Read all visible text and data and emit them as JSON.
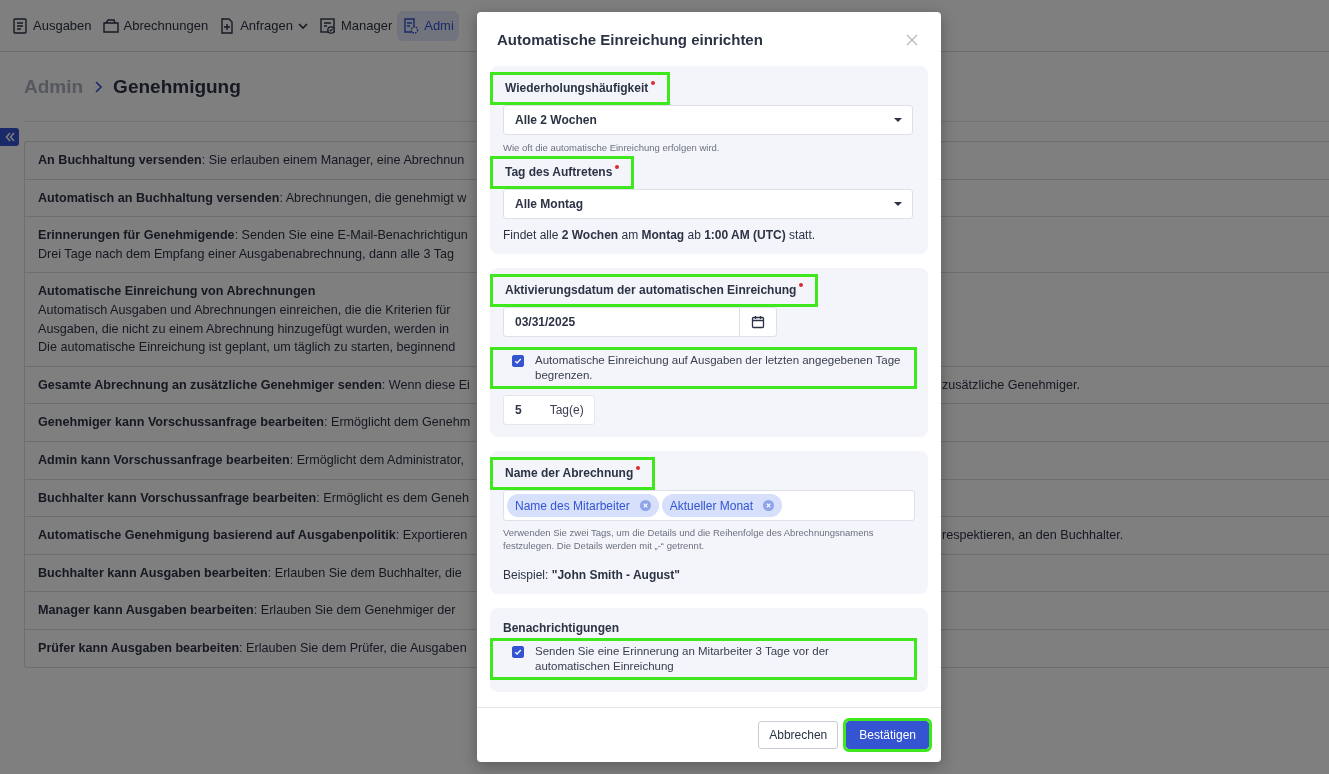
{
  "nav": {
    "items": [
      {
        "label": "Ausgaben",
        "selected": false,
        "dropdown": false
      },
      {
        "label": "Abrechnungen",
        "selected": false,
        "dropdown": false
      },
      {
        "label": "Anfragen",
        "selected": false,
        "dropdown": true
      },
      {
        "label": "Manager",
        "selected": false,
        "dropdown": false
      },
      {
        "label": "Admi",
        "selected": true,
        "dropdown": false
      }
    ]
  },
  "breadcrumb": {
    "parent": "Admin",
    "current": "Genehmigung"
  },
  "settings": {
    "rows": [
      {
        "lines": [
          "**An Buchhaltung versenden**: Sie erlauben einem Manager, eine Abrechnun"
        ]
      },
      {
        "lines": [
          "**Automatisch an Buchhaltung versenden**: Abrechnungen, die genehmigt w"
        ]
      },
      {
        "lines": [
          "**Erinnerungen für Genehmigende**: Senden Sie eine E-Mail-Benachrichtigun",
          "Drei Tage nach dem Empfang einer Ausgabenabrechnung, dann alle 3 Tag"
        ]
      },
      {
        "lines": [
          "**Automatische Einreichung von Abrechnungen**",
          "Automatisch Ausgaben und Abrechnungen einreichen, die die Kriterien für",
          "Ausgaben, die nicht zu einem Abrechnung hinzugefügt wurden, werden in",
          "Die automatische Einreichung ist geplant, um täglich zu starten, beginnend"
        ]
      },
      {
        "lines": [
          "**Gesamte Abrechnung an zusätzliche Genehmiger senden**: Wenn diese Ei"
        ],
        "tail": "zusätzliche Genehmiger."
      },
      {
        "lines": [
          "**Genehmiger kann Vorschussanfrage bearbeiten**: Ermöglicht dem Genehm"
        ]
      },
      {
        "lines": [
          "**Admin kann Vorschussanfrage bearbeiten**: Ermöglicht dem Administrator,"
        ]
      },
      {
        "lines": [
          "**Buchhalter kann Vorschussanfrage bearbeiten**: Ermöglicht es dem Geneh"
        ]
      },
      {
        "lines": [
          "**Automatische Genehmigung basierend auf Ausgabenpolitik**: Exportieren"
        ],
        "tail": "respektieren, an den Buchhalter."
      },
      {
        "lines": [
          "**Buchhalter kann Ausgaben bearbeiten**: Erlauben Sie dem Buchhalter, die"
        ]
      },
      {
        "lines": [
          "**Manager kann Ausgaben bearbeiten**: Erlauben Sie dem Genehmiger der"
        ]
      },
      {
        "lines": [
          "**Prüfer kann Ausgaben bearbeiten**: Erlauben Sie dem Prüfer, die Ausgaben"
        ]
      }
    ]
  },
  "modal": {
    "title": "Automatische Einreichung einrichten",
    "frequency": {
      "label": "Wiederholungshäufigkeit",
      "required": true,
      "highlighted": true,
      "value": "Alle 2 Wochen",
      "hint": "Wie oft die automatische Einreichung erfolgen wird."
    },
    "day": {
      "label": "Tag des Auftretens",
      "required": true,
      "highlighted": true,
      "value": "Alle Montag"
    },
    "summary": "Findet alle **2 Wochen** am **Montag** ab **1:00 AM (UTC)** statt.",
    "activation": {
      "label": "Aktivierungsdatum der automatischen Einreichung",
      "required": true,
      "highlighted": true,
      "date": "03/31/2025",
      "limit": {
        "label": "Automatische Einreichung auf Ausgaben der letzten angegebenen Tage begrenzen.",
        "checked": true,
        "highlighted": true
      },
      "days": {
        "value": "5",
        "unit": "Tag(e)"
      }
    },
    "report_name": {
      "label": "Name der Abrechnung",
      "required": true,
      "highlighted": true,
      "tags": [
        "Name des Mitarbeiter",
        "Aktueller Monat"
      ],
      "hint": "Verwenden Sie zwei Tags, um die Details und die Reihenfolge des Abrechnungsnamens festzulegen. Die Details werden mit „-“ getrennt.",
      "example": "Beispiel: **\"John Smith - August\"**"
    },
    "notifications": {
      "heading": "Benachrichtigungen",
      "reminder": {
        "label": "Senden Sie eine Erinnerung an Mitarbeiter 3 Tage vor der automatischen Einreichung",
        "checked": true,
        "highlighted": true
      }
    },
    "buttons": [
      {
        "label": "Abbrechen",
        "kind": "secondary",
        "highlighted": false
      },
      {
        "label": "Bestätigen",
        "kind": "primary",
        "highlighted": true
      }
    ]
  }
}
